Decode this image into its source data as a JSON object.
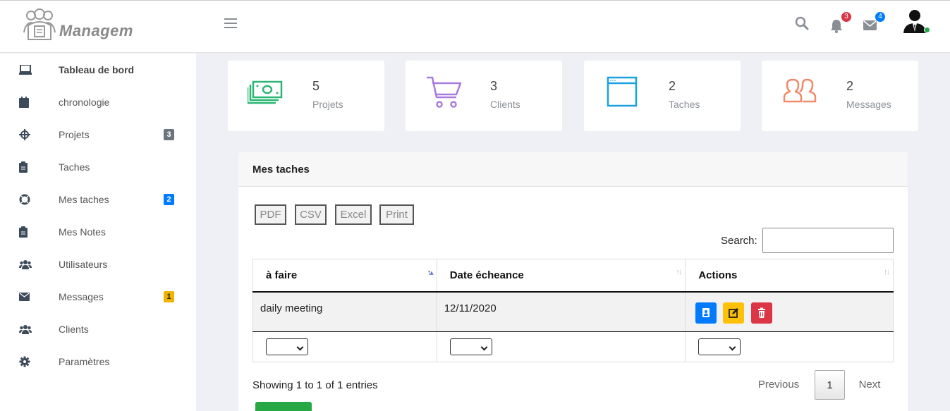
{
  "brand": {
    "name": "Managem"
  },
  "topbar": {
    "notifications_count": "3",
    "messages_count": "4",
    "colors": {
      "danger": "#dc3545",
      "primary": "#007bff"
    }
  },
  "sidebar": {
    "items": [
      {
        "label": "Tableau de bord",
        "icon": "laptop-icon"
      },
      {
        "label": "chronologie",
        "icon": "calendar-icon"
      },
      {
        "label": "Projets",
        "icon": "crosshair-icon",
        "badge": "3"
      },
      {
        "label": "Taches",
        "icon": "clipboard-icon"
      },
      {
        "label": "Mes taches",
        "icon": "life-ring-icon",
        "badge": "2"
      },
      {
        "label": "Mes Notes",
        "icon": "clipboard-icon"
      },
      {
        "label": "Utilisateurs",
        "icon": "users-icon"
      },
      {
        "label": "Messages",
        "icon": "envelope-icon",
        "badge": "1"
      },
      {
        "label": "Clients",
        "icon": "users-icon"
      },
      {
        "label": "Paramètres",
        "icon": "gear-icon"
      }
    ]
  },
  "cards": [
    {
      "value": "5",
      "label": "Projets",
      "icon": "money-icon",
      "color": "#2bb673"
    },
    {
      "value": "3",
      "label": "Clients",
      "icon": "cart-icon",
      "color": "#a77bdf"
    },
    {
      "value": "2",
      "label": "Taches",
      "icon": "window-icon",
      "color": "#1ba1e2"
    },
    {
      "value": "2",
      "label": "Messages",
      "icon": "users-icon",
      "color": "#f08a6b"
    }
  ],
  "panel": {
    "title": "Mes taches",
    "export_buttons": [
      "PDF",
      "CSV",
      "Excel",
      "Print"
    ],
    "search_label": "Search:",
    "search_value": "",
    "columns": [
      "à faire",
      "Date écheance",
      "Actions"
    ],
    "rows": [
      {
        "todo": "daily meeting",
        "due": "12/11/2020"
      }
    ],
    "info": "Showing 1 to 1 of 1 entries",
    "pagination": {
      "previous": "Previous",
      "current": "1",
      "next": "Next"
    }
  }
}
